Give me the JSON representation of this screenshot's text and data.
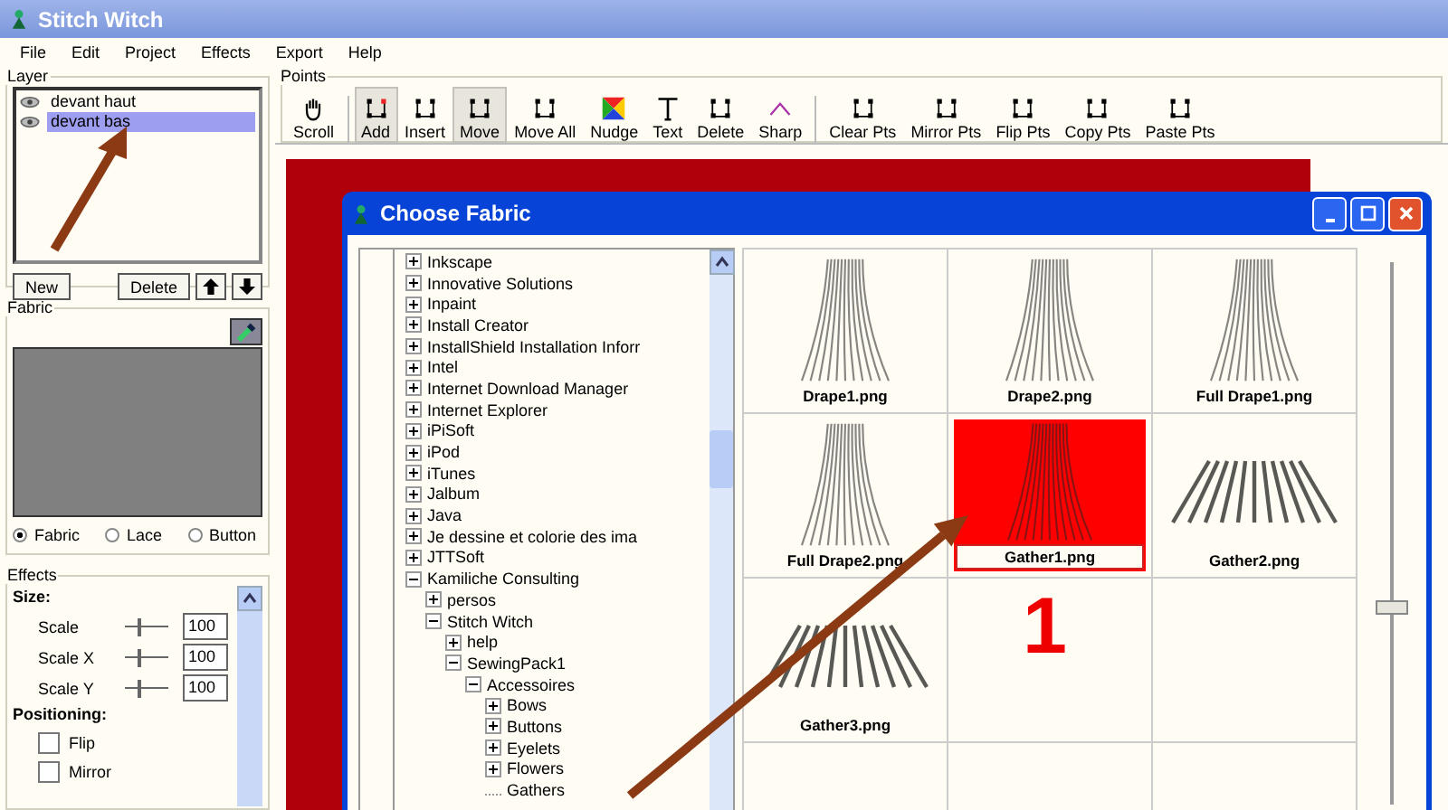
{
  "window": {
    "title": "Stitch Witch"
  },
  "menu": [
    "File",
    "Edit",
    "Project",
    "Effects",
    "Export",
    "Help"
  ],
  "layer_panel": {
    "title": "Layer",
    "layers": [
      {
        "name": "devant haut",
        "selected": false
      },
      {
        "name": "devant bas",
        "selected": true
      }
    ],
    "buttons": [
      "New",
      "Delete"
    ]
  },
  "fabric_panel": {
    "title": "Fabric",
    "options": [
      {
        "label": "Fabric",
        "selected": true
      },
      {
        "label": "Lace",
        "selected": false
      },
      {
        "label": "Button",
        "selected": false
      }
    ]
  },
  "effects_panel": {
    "title": "Effects",
    "sections": [
      {
        "heading": "Size:",
        "rows": [
          {
            "kind": "slider",
            "label": "Scale",
            "level": 0.3,
            "value": "100"
          },
          {
            "kind": "slider",
            "label": "Scale X",
            "level": 0.3,
            "value": "100"
          },
          {
            "kind": "slider",
            "label": "Scale Y",
            "level": 0.3,
            "value": "100"
          }
        ]
      },
      {
        "heading": "Positioning:",
        "rows": [
          {
            "kind": "checkbox",
            "label": "Flip",
            "checked": false
          },
          {
            "kind": "checkbox",
            "label": "Mirror",
            "checked": false
          }
        ]
      }
    ]
  },
  "points_toolbar": {
    "title": "Points",
    "groups": [
      [
        {
          "kind": "scroll",
          "label": "Scroll",
          "selected": false
        }
      ],
      [
        {
          "kind": "add",
          "label": "Add",
          "selected": true
        },
        {
          "kind": "insert",
          "label": "Insert",
          "selected": false
        },
        {
          "kind": "move",
          "label": "Move",
          "selected": true
        },
        {
          "kind": "moveall",
          "label": "Move All",
          "selected": false
        },
        {
          "kind": "nudge",
          "label": "Nudge",
          "selected": false
        },
        {
          "kind": "text",
          "label": "Text",
          "selected": false
        },
        {
          "kind": "delete",
          "label": "Delete",
          "selected": false
        },
        {
          "kind": "sharp",
          "label": "Sharp",
          "selected": false
        }
      ],
      [
        {
          "kind": "clear",
          "label": "Clear Pts",
          "selected": false
        },
        {
          "kind": "mirror",
          "label": "Mirror Pts",
          "selected": false
        },
        {
          "kind": "flip",
          "label": "Flip Pts",
          "selected": false
        },
        {
          "kind": "copy",
          "label": "Copy Pts",
          "selected": false
        },
        {
          "kind": "paste",
          "label": "Paste Pts",
          "selected": false
        }
      ]
    ]
  },
  "fabric_dialog": {
    "title": "Choose Fabric",
    "tree": [
      {
        "label": "Inkscape",
        "expanded": false
      },
      {
        "label": "Innovative Solutions",
        "expanded": false
      },
      {
        "label": "Inpaint",
        "expanded": false
      },
      {
        "label": "Install Creator",
        "expanded": false
      },
      {
        "label": "InstallShield Installation Inforr",
        "expanded": false
      },
      {
        "label": "Intel",
        "expanded": false
      },
      {
        "label": "Internet Download Manager",
        "expanded": false
      },
      {
        "label": "Internet Explorer",
        "expanded": false
      },
      {
        "label": "iPiSoft",
        "expanded": false
      },
      {
        "label": "iPod",
        "expanded": false
      },
      {
        "label": "iTunes",
        "expanded": false
      },
      {
        "label": "Jalbum",
        "expanded": false
      },
      {
        "label": "Java",
        "expanded": false
      },
      {
        "label": "Je dessine et colorie des ima",
        "expanded": false
      },
      {
        "label": "JTTSoft",
        "expanded": false
      },
      {
        "label": "Kamiliche Consulting",
        "expanded": true,
        "children": [
          {
            "label": "persos",
            "expanded": false
          },
          {
            "label": "Stitch Witch",
            "expanded": true,
            "children": [
              {
                "label": "help",
                "expanded": false
              },
              {
                "label": "SewingPack1",
                "expanded": true,
                "children": [
                  {
                    "label": "Accessoires",
                    "expanded": true,
                    "children": [
                      {
                        "label": "Bows",
                        "expanded": false
                      },
                      {
                        "label": "Buttons",
                        "expanded": false
                      },
                      {
                        "label": "Eyelets",
                        "expanded": false
                      },
                      {
                        "label": "Flowers",
                        "expanded": false
                      },
                      {
                        "label": "Gathers",
                        "kind": "leaf"
                      }
                    ]
                  }
                ]
              }
            ]
          }
        ]
      }
    ],
    "thumbnails": [
      {
        "kind": "drape",
        "name": "Drape1.png",
        "selected": false
      },
      {
        "kind": "drape",
        "name": "Drape2.png",
        "selected": false
      },
      {
        "kind": "drape",
        "name": "Full Drape1.png",
        "selected": false
      },
      {
        "kind": "drape",
        "name": "Full Drape2.png",
        "selected": false
      },
      {
        "kind": "drape",
        "name": "Gather1.png",
        "selected": true
      },
      {
        "kind": "fan",
        "name": "Gather2.png",
        "selected": false
      },
      {
        "kind": "fan",
        "name": "Gather3.png",
        "selected": false
      }
    ],
    "zoom_slider": {
      "level": 0.35
    }
  },
  "annotation": {
    "number": "1"
  }
}
